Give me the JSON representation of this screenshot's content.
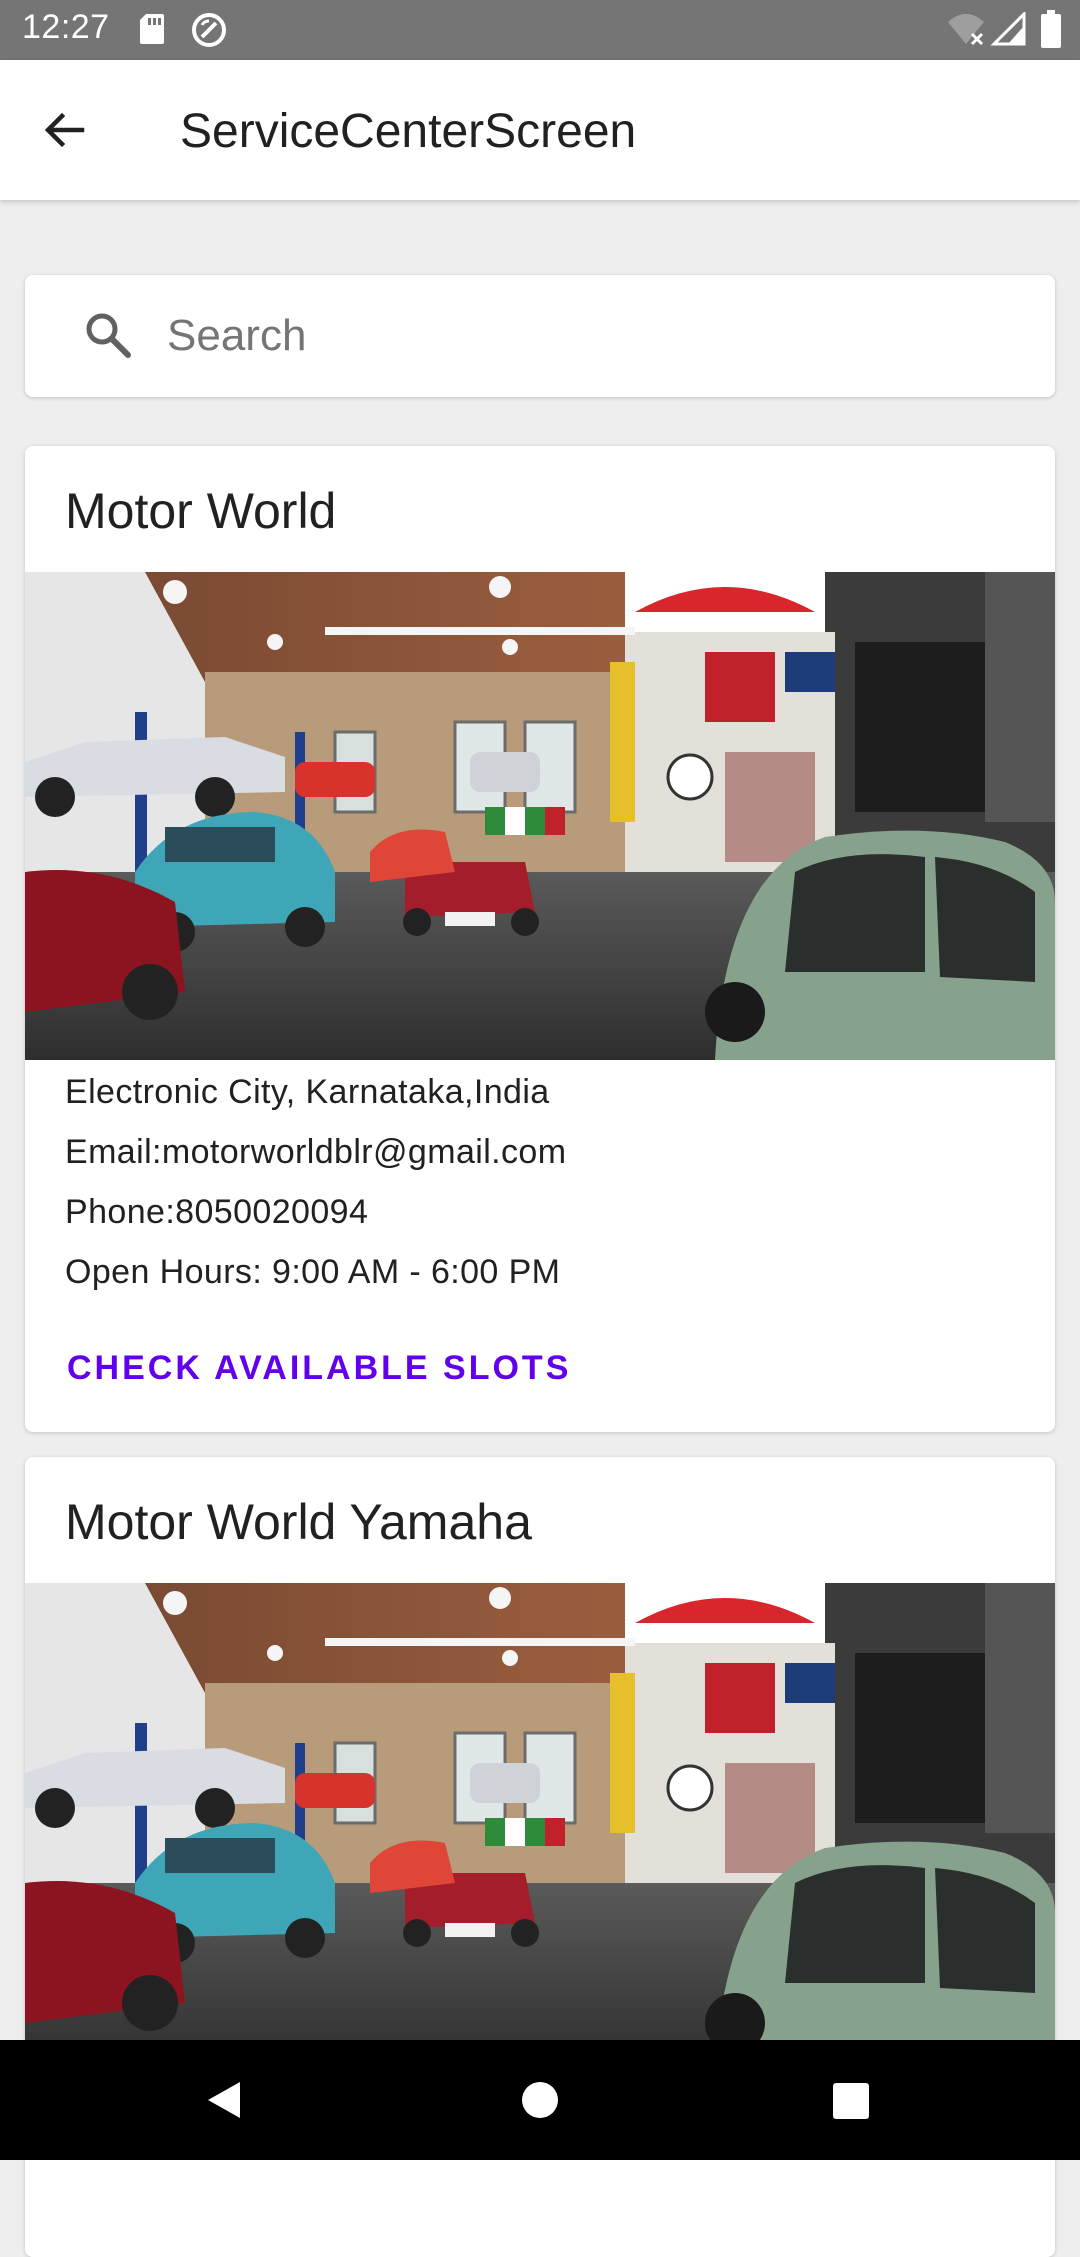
{
  "status_bar": {
    "time": "12:27",
    "icons": [
      "sd-card-icon",
      "do-not-disturb-icon",
      "wifi-off-icon",
      "signal-icon",
      "battery-icon"
    ]
  },
  "app_bar": {
    "title": "ServiceCenterScreen",
    "back_icon": "arrow-back-icon"
  },
  "search": {
    "placeholder": "Search",
    "value": "",
    "icon": "search-icon"
  },
  "service_centers": [
    {
      "name": "Motor World",
      "address": "Electronic City, Karnataka,India",
      "email": "Email:motorworldblr@gmail.com",
      "phone": "Phone:8050020094",
      "hours": "Open Hours: 9:00 AM - 6:00 PM",
      "action_label": "CHECK AVAILABLE SLOTS"
    },
    {
      "name": "Motor World Yamaha"
    }
  ],
  "nav_bar": {
    "icons": [
      "nav-back-icon",
      "nav-home-icon",
      "nav-recents-icon"
    ]
  },
  "colors": {
    "accent": "#6200ee",
    "status_bar": "#757575",
    "background": "#eeeeee",
    "card": "#ffffff",
    "nav_bar": "#000000"
  }
}
